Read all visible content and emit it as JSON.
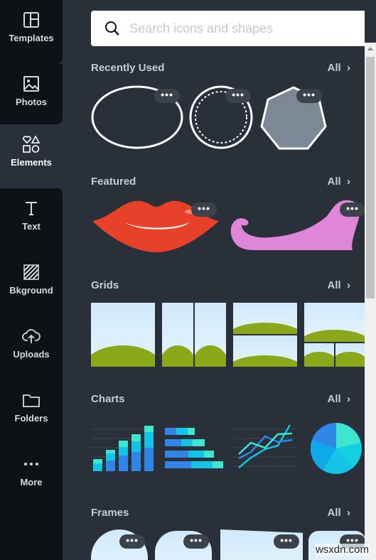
{
  "sidebar": {
    "items": [
      {
        "label": "Templates",
        "icon": "templates-icon"
      },
      {
        "label": "Photos",
        "icon": "photos-icon"
      },
      {
        "label": "Elements",
        "icon": "elements-icon",
        "active": true
      },
      {
        "label": "Text",
        "icon": "text-icon"
      },
      {
        "label": "Bkground",
        "icon": "background-icon"
      },
      {
        "label": "Uploads",
        "icon": "uploads-icon"
      },
      {
        "label": "Folders",
        "icon": "folders-icon"
      },
      {
        "label": "More",
        "icon": "more-icon"
      }
    ]
  },
  "search": {
    "placeholder": "Search icons and shapes"
  },
  "sections": [
    {
      "title": "Recently Used",
      "all": "All"
    },
    {
      "title": "Featured",
      "all": "All"
    },
    {
      "title": "Grids",
      "all": "All"
    },
    {
      "title": "Charts",
      "all": "All"
    },
    {
      "title": "Frames",
      "all": "All"
    }
  ],
  "more_label": "•••",
  "colors": {
    "sidebar": "#0e1217",
    "panel": "#293039",
    "chart_blue": "#2f86e6",
    "chart_cyan": "#14c4e6",
    "chart_teal": "#3ee6d0"
  },
  "watermark": "wsxdn.com"
}
